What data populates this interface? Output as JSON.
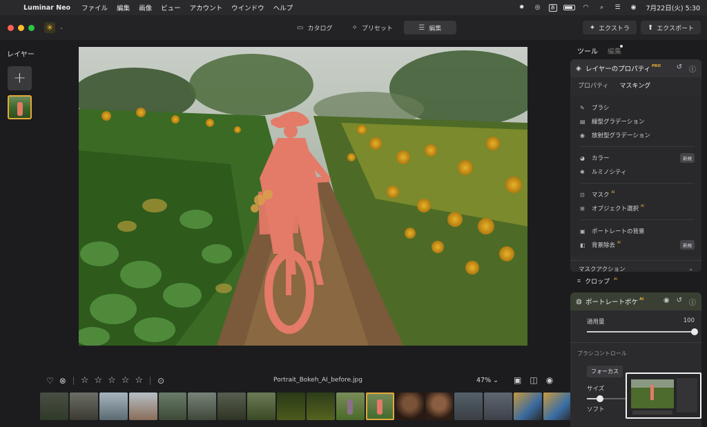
{
  "menubar": {
    "app_name": "Luminar Neo",
    "items": [
      "ファイル",
      "編集",
      "画像",
      "ビュー",
      "アカウント",
      "ウインドウ",
      "ヘルプ"
    ],
    "input_badge": "あ",
    "clock": "7月22日(火) 5:30"
  },
  "topbar": {
    "tabs": [
      {
        "label": "カタログ",
        "icon": "folder-icon"
      },
      {
        "label": "プリセット",
        "icon": "sparkle-icon"
      },
      {
        "label": "編集",
        "icon": "sliders-icon"
      }
    ],
    "extras_label": "エクストラ",
    "export_label": "エクスポート"
  },
  "layers": {
    "title": "レイヤー",
    "add_symbol": "+"
  },
  "bottombar": {
    "filename": "Portrait_Bokeh_AI_before.jpg",
    "zoom": "47% ⌄",
    "rating": 0
  },
  "rpanel": {
    "tab_tools": "ツール",
    "tab_edit": "編集",
    "layer_props": {
      "title": "レイヤーのプロパティ",
      "pro": "PRO",
      "subtab_props": "プロパティ",
      "subtab_masking": "マスキング",
      "groups": [
        [
          {
            "label": "ブラシ",
            "icon": "brush-icon"
          },
          {
            "label": "線型グラデーション",
            "icon": "linear-gradient-icon"
          },
          {
            "label": "放射型グラデーション",
            "icon": "radial-gradient-icon"
          }
        ],
        [
          {
            "label": "カラー",
            "icon": "color-icon",
            "badge": "新規"
          },
          {
            "label": "ルミノシティ",
            "icon": "luminosity-icon"
          }
        ],
        [
          {
            "label": "マスク",
            "icon": "mask-icon",
            "ai": "AI"
          },
          {
            "label": "オブジェクト選択",
            "icon": "object-select-icon",
            "ai": "AI"
          }
        ],
        [
          {
            "label": "ポートレートの背景",
            "icon": "portrait-bg-icon"
          },
          {
            "label": "背景除去",
            "icon": "bg-remove-icon",
            "ai": "AI",
            "badge": "新規"
          }
        ]
      ],
      "mask_action": "マスクアクション"
    },
    "crop": {
      "label": "クロップ",
      "ai": "AI"
    },
    "portrait_bokeh": {
      "title": "ポートレートボケ",
      "ai": "AI",
      "amount_label": "適用量",
      "amount_value": "100",
      "amount": 1.0,
      "brush_controls": "ブラシコントロール",
      "focus_label": "フォーカス",
      "size_label": "サイズ",
      "size": 0.3,
      "soft_label": "ソフト",
      "soft_value": "100"
    }
  },
  "colors": {
    "accent": "#e6a93a",
    "mask_overlay": "#e47a68",
    "panel": "#2b2b2e"
  }
}
